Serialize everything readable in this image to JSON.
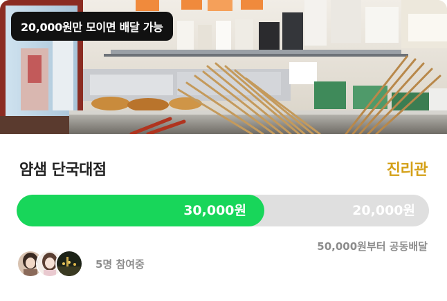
{
  "promo": {
    "amount": "20,000원",
    "text": "만 모이면 배달 가능"
  },
  "store": {
    "name": "얌샘 단국대점",
    "location": "진리관"
  },
  "progress": {
    "collected_label": "30,000원",
    "remaining_label": "20,000원",
    "fraction": 0.6
  },
  "delivery": {
    "min_order_text": "50,000원부터 공동배달"
  },
  "participants": {
    "text": "5명 참여중"
  },
  "colors": {
    "accent_green": "#18d65a",
    "location_gold": "#d4a017",
    "muted_text": "#8c8c8c"
  }
}
